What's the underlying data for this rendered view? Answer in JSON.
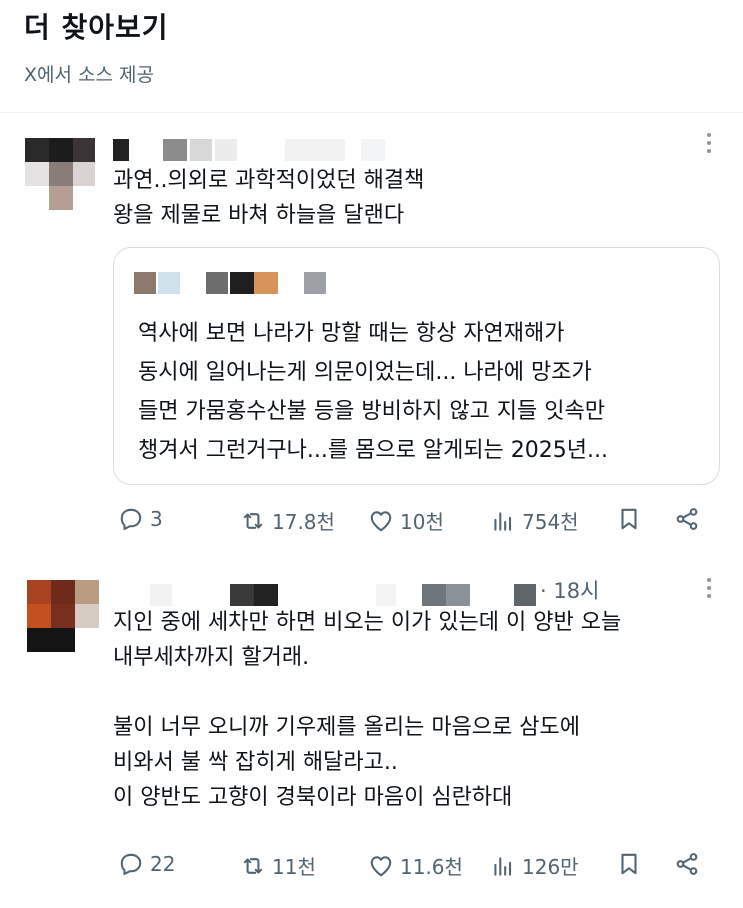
{
  "header": {
    "title": "더 찾아보기",
    "subtitle": "X에서 소스 제공"
  },
  "posts": [
    {
      "text": "과연..의외로 과학적이었던 해결책\n왕을 제물로 바쳐 하늘을 달랜다",
      "quote": {
        "text": "역사에 보면 나라가 망할 때는 항상 자연재해가\n동시에 일어나는게 의문이었는데... 나라에 망조가\n들면 가뭄홍수산불 등을 방비하지 않고 지들 잇속만\n챙겨서 그런거구나...를 몸으로 알게되는 2025년..."
      },
      "stats": {
        "replies": "3",
        "reposts": "17.8천",
        "likes": "10천",
        "views": "754천"
      }
    },
    {
      "timestamp": "· 18시",
      "text": "지인 중에 세차만 하면 비오는 이가 있는데 이 양반 오늘\n내부세차까지 할거래.\n\n불이 너무 오니까 기우제를 올리는 마음으로 삼도에\n비와서 불 싹 잡히게 해달라고..\n이 양반도 고향이 경북이라 마음이 심란하대",
      "stats": {
        "replies": "22",
        "reposts": "11천",
        "likes": "11.6천",
        "views": "126만"
      }
    }
  ],
  "icons": {
    "reply": "reply-icon",
    "repost": "repost-icon",
    "like": "heart-icon",
    "views": "views-icon",
    "bookmark": "bookmark-icon",
    "share": "share-icon",
    "more": "more-icon"
  },
  "colors": {
    "text": "#0f1419",
    "secondary": "#536471",
    "border": "#d6dfe3"
  }
}
